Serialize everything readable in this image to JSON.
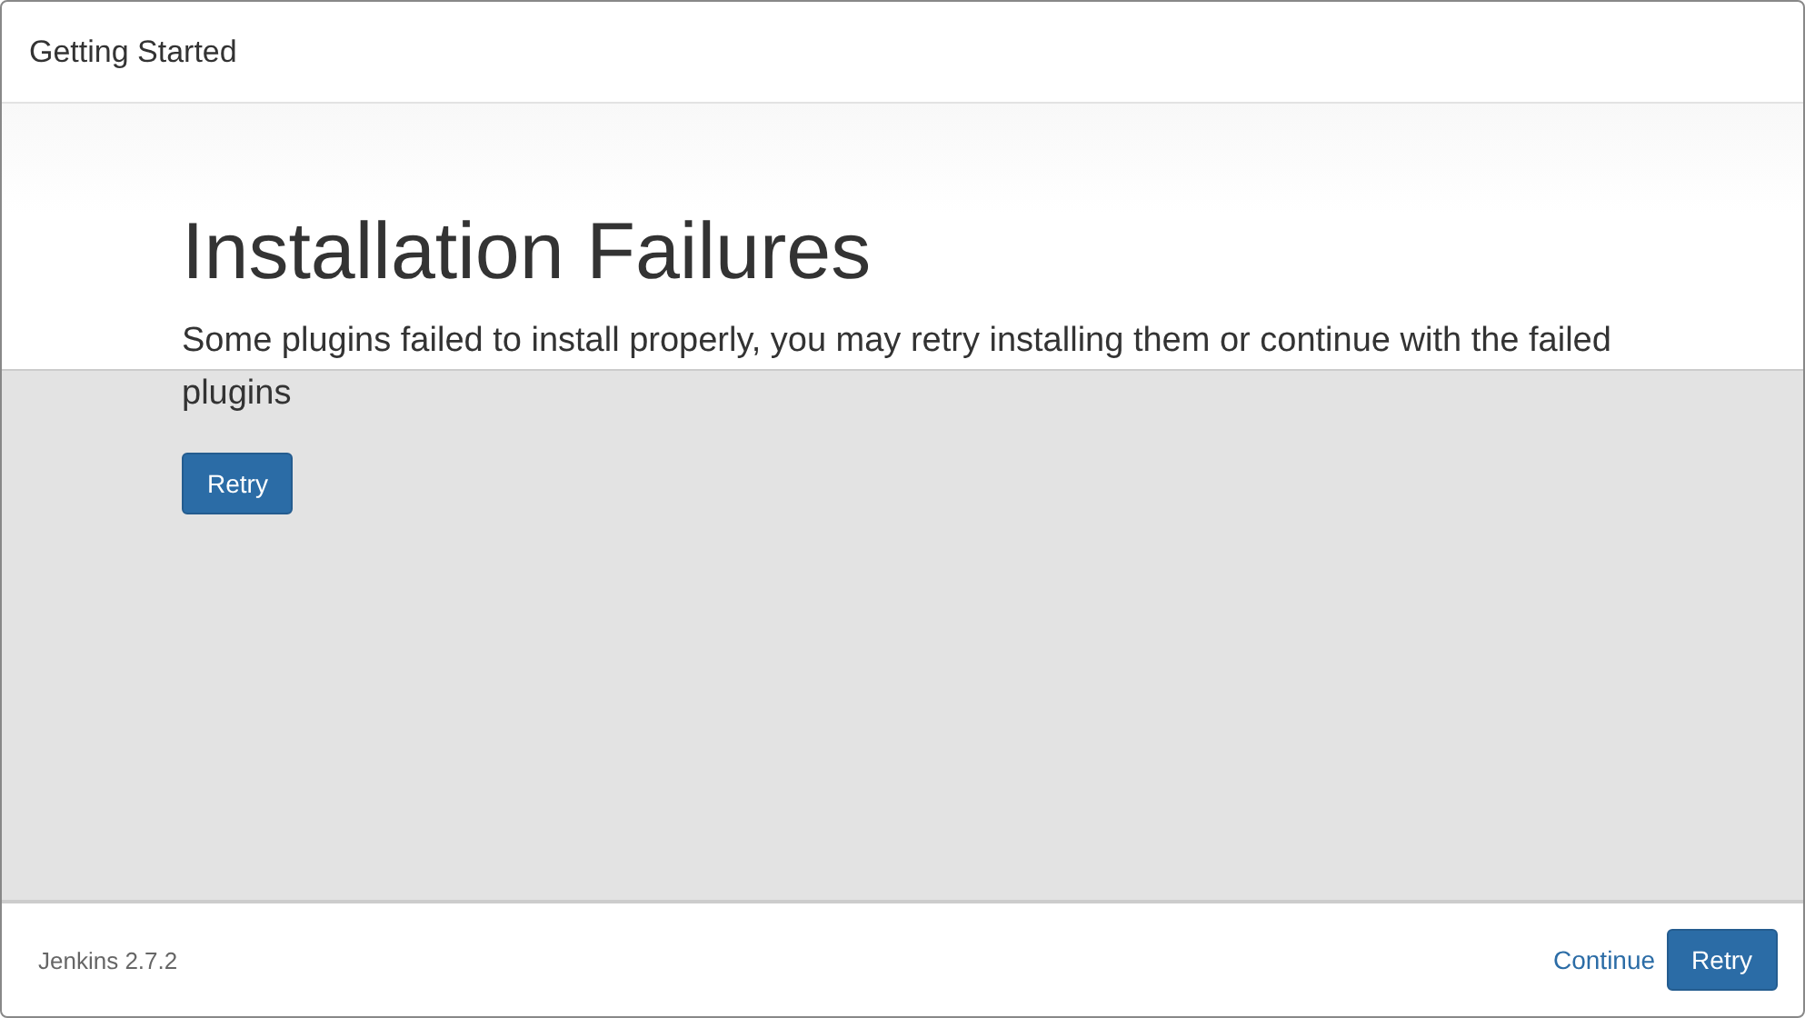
{
  "window": {
    "title": "Getting Started"
  },
  "content": {
    "heading": "Installation Failures",
    "message": "Some plugins failed to install properly, you may retry installing them or continue with the failed plugins",
    "button": "Retry"
  },
  "footer": {
    "version": "Jenkins 2.7.2",
    "actions": [
      {
        "kind": "link",
        "label": "Continue"
      },
      {
        "kind": "primary",
        "label": "Retry"
      }
    ]
  }
}
